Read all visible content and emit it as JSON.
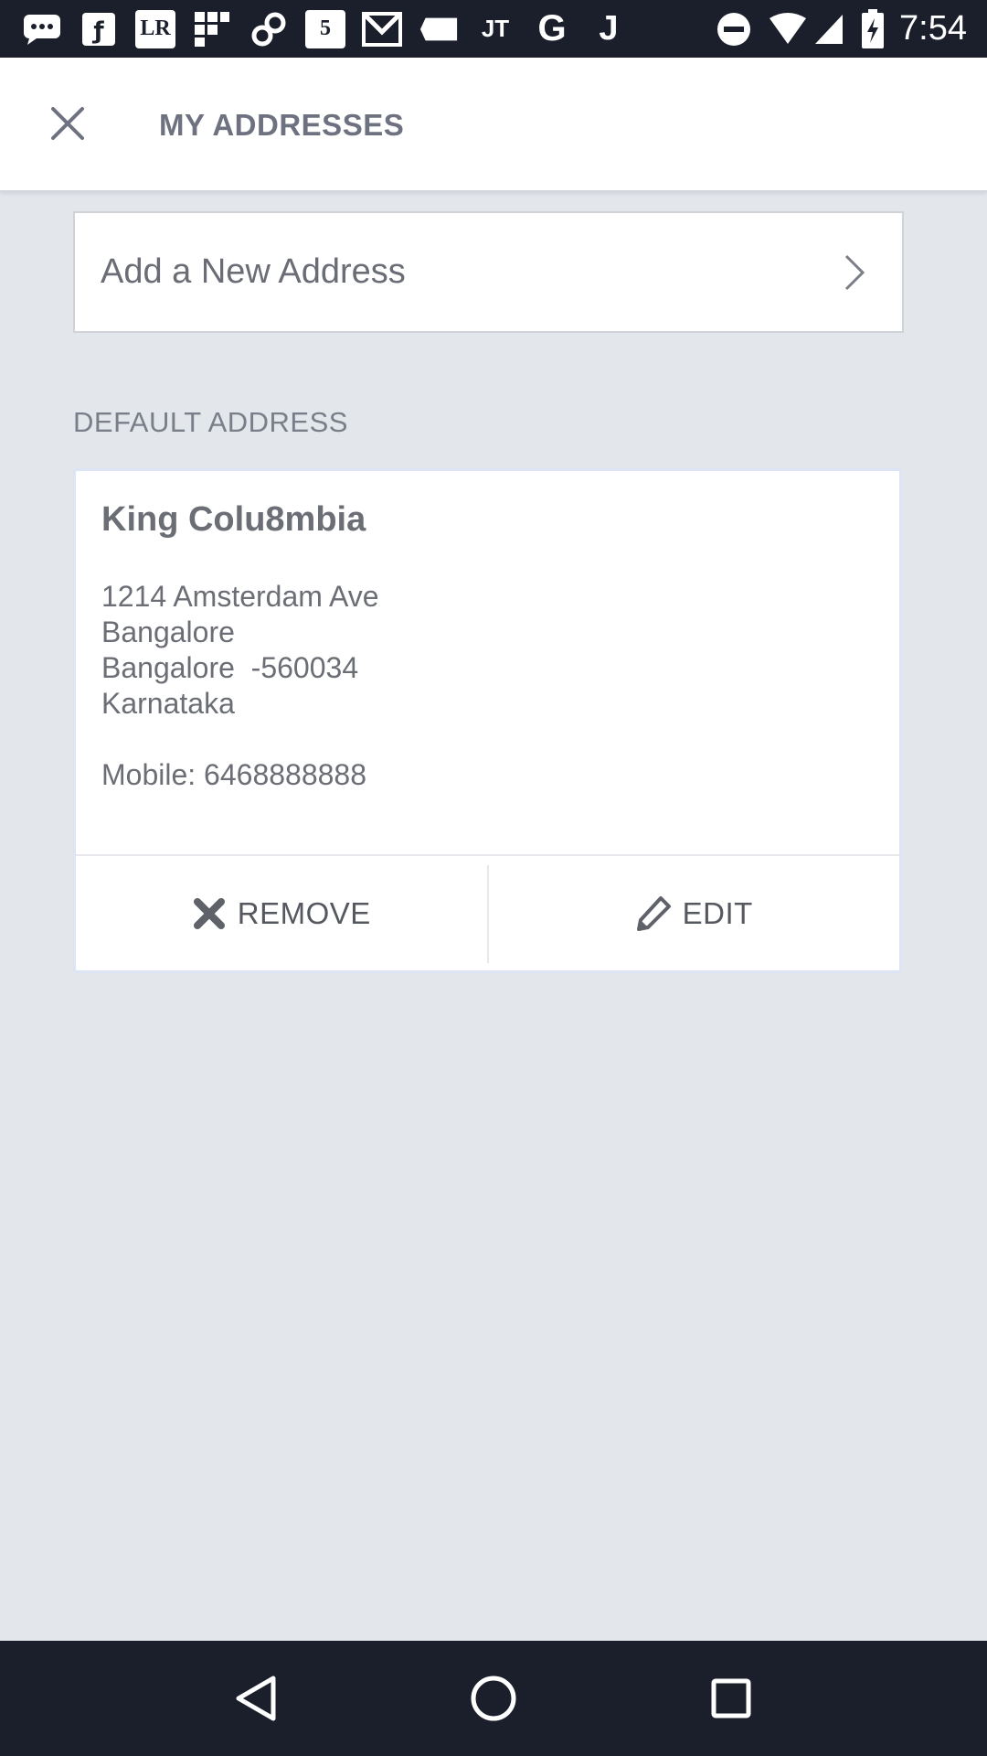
{
  "status_bar": {
    "time": "7:54",
    "notification_icons": [
      "chat-bubble-icon",
      "lyft-icon",
      "lr-icon",
      "grid-icon",
      "link-icon",
      "five-icon",
      "gmail-icon",
      "tag-icon",
      "jt-icon",
      "google-icon",
      "j-icon"
    ],
    "lr_text": "LR",
    "five_text": "5",
    "jt_text": "JT",
    "g_text": "G",
    "j_text": "J"
  },
  "app_bar": {
    "title": "MY ADDRESSES"
  },
  "add_address": {
    "label": "Add a New Address"
  },
  "default_section": {
    "label": "DEFAULT ADDRESS"
  },
  "address_card": {
    "name": "King Colu8mbia",
    "line1": "1214 Amsterdam Ave",
    "line2": "Bangalore",
    "line3": "Bangalore  -560034",
    "line4": "Karnataka",
    "mobile": "Mobile: 6468888888",
    "remove_label": "REMOVE",
    "edit_label": "EDIT"
  },
  "colors": {
    "status_bar_bg": "#1b1f2b",
    "background": "#e3e7ec",
    "text_gray": "#6b6e75"
  }
}
